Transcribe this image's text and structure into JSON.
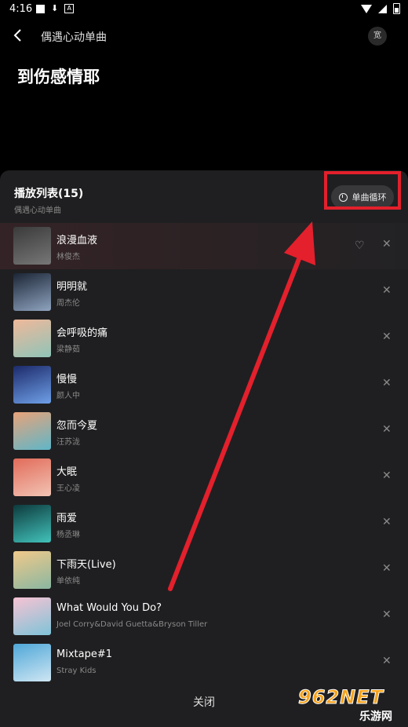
{
  "status": {
    "time": "4:16"
  },
  "header": {
    "title": "偶遇心动单曲",
    "badge": "宽"
  },
  "now_playing": {
    "title": "到伤感情耶"
  },
  "playlist": {
    "title": "播放列表(15)",
    "subtitle": "偶遇心动单曲",
    "mode_label": "单曲循环",
    "items": [
      {
        "title": "浪漫血液",
        "artist": "林俊杰",
        "active": true,
        "thumb": [
          "#3a3a3a",
          "#777"
        ]
      },
      {
        "title": "明明就",
        "artist": "周杰伦",
        "thumb": [
          "#1b2535",
          "#8fa4c0"
        ]
      },
      {
        "title": "会呼吸的痛",
        "artist": "梁静茹",
        "thumb": [
          "#f0b89a",
          "#8fc4b8"
        ]
      },
      {
        "title": "慢慢",
        "artist": "颜人中",
        "thumb": [
          "#1c2a6a",
          "#6fa0e8"
        ]
      },
      {
        "title": "忽而今夏",
        "artist": "汪苏泷",
        "thumb": [
          "#e8a37a",
          "#5fb6c8"
        ]
      },
      {
        "title": "大眠",
        "artist": "王心凌",
        "thumb": [
          "#e26b5a",
          "#f2c4b4"
        ]
      },
      {
        "title": "雨爱",
        "artist": "杨丞琳",
        "thumb": [
          "#0d3a3d",
          "#42c3bb"
        ]
      },
      {
        "title": "下雨天(Live)",
        "artist": "单依纯",
        "thumb": [
          "#f1c98a",
          "#8ab7a1"
        ]
      },
      {
        "title": "What Would You Do?",
        "artist": "Joel Corry&David Guetta&Bryson Tiller",
        "thumb": [
          "#f7c3d3",
          "#7fc3d8"
        ]
      },
      {
        "title": "Mixtape#1",
        "artist": "Stray Kids",
        "thumb": [
          "#4fa7d8",
          "#cfe6f3"
        ]
      }
    ]
  },
  "footer": {
    "close_label": "关闭"
  },
  "watermark": {
    "logo": "962NET",
    "sub": "乐游网"
  },
  "colors": {
    "highlight": "#e3202c",
    "accent_arrow": "#e3202c"
  }
}
